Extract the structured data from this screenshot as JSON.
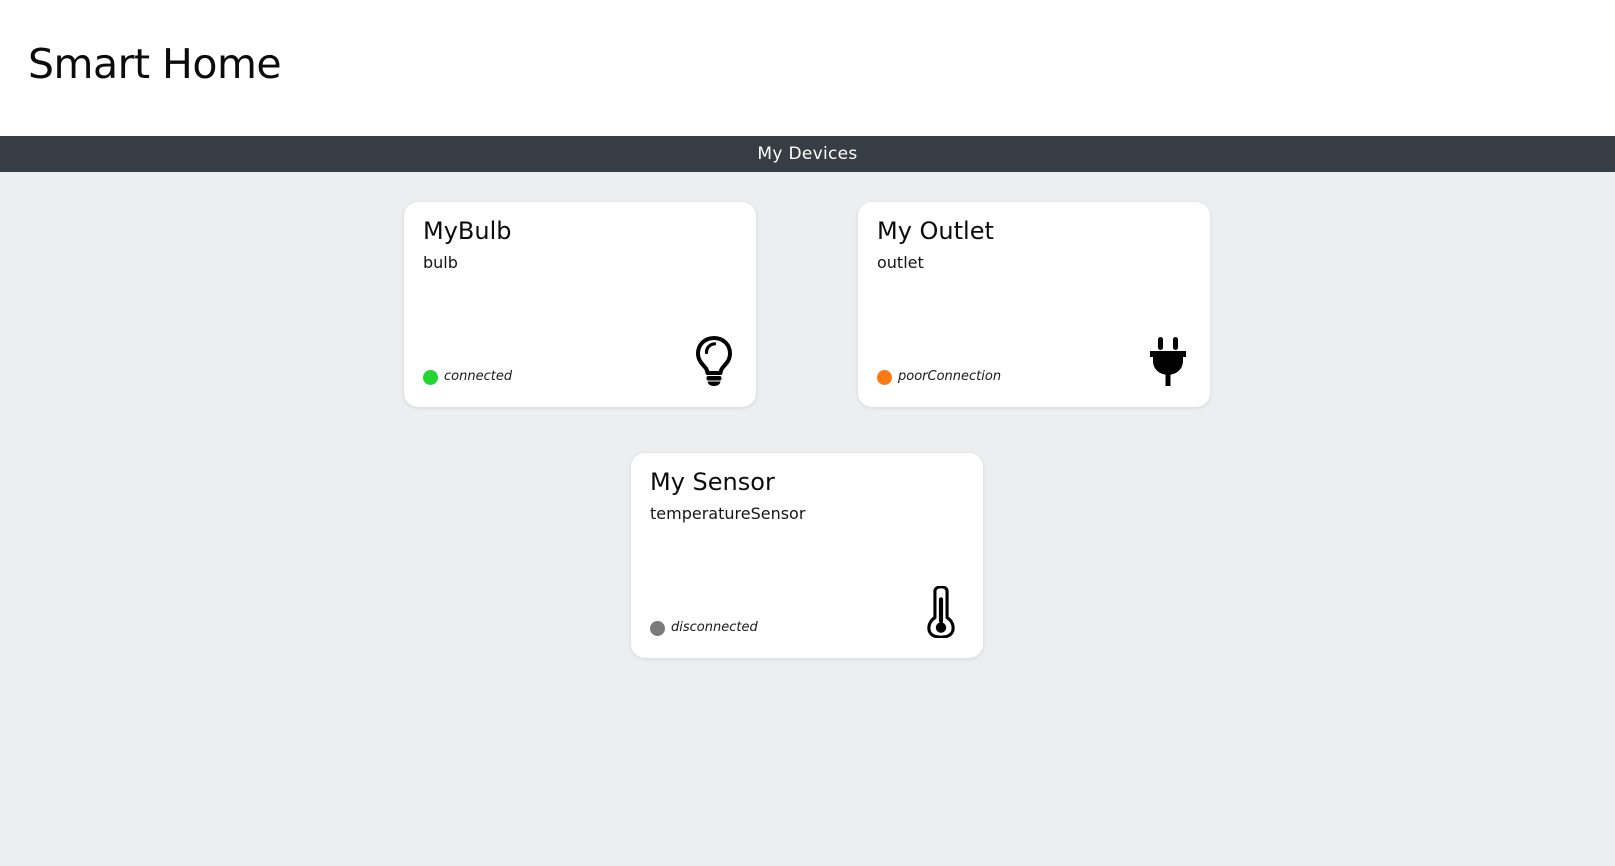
{
  "app": {
    "title": "Smart Home"
  },
  "section": {
    "title": "My Devices"
  },
  "colors": {
    "connected": "#20d62f",
    "poorConnection": "#fb7a14",
    "disconnected": "#7b7b7b",
    "section_bar": "#363d45",
    "page_background": "#edeef0"
  },
  "devices": [
    {
      "name": "MyBulb",
      "type": "bulb",
      "status": "connected",
      "icon": "lightbulb-icon"
    },
    {
      "name": "My Outlet",
      "type": "outlet",
      "status": "poorConnection",
      "icon": "plug-icon"
    },
    {
      "name": "My Sensor",
      "type": "temperatureSensor",
      "status": "disconnected",
      "icon": "thermometer-icon"
    }
  ]
}
